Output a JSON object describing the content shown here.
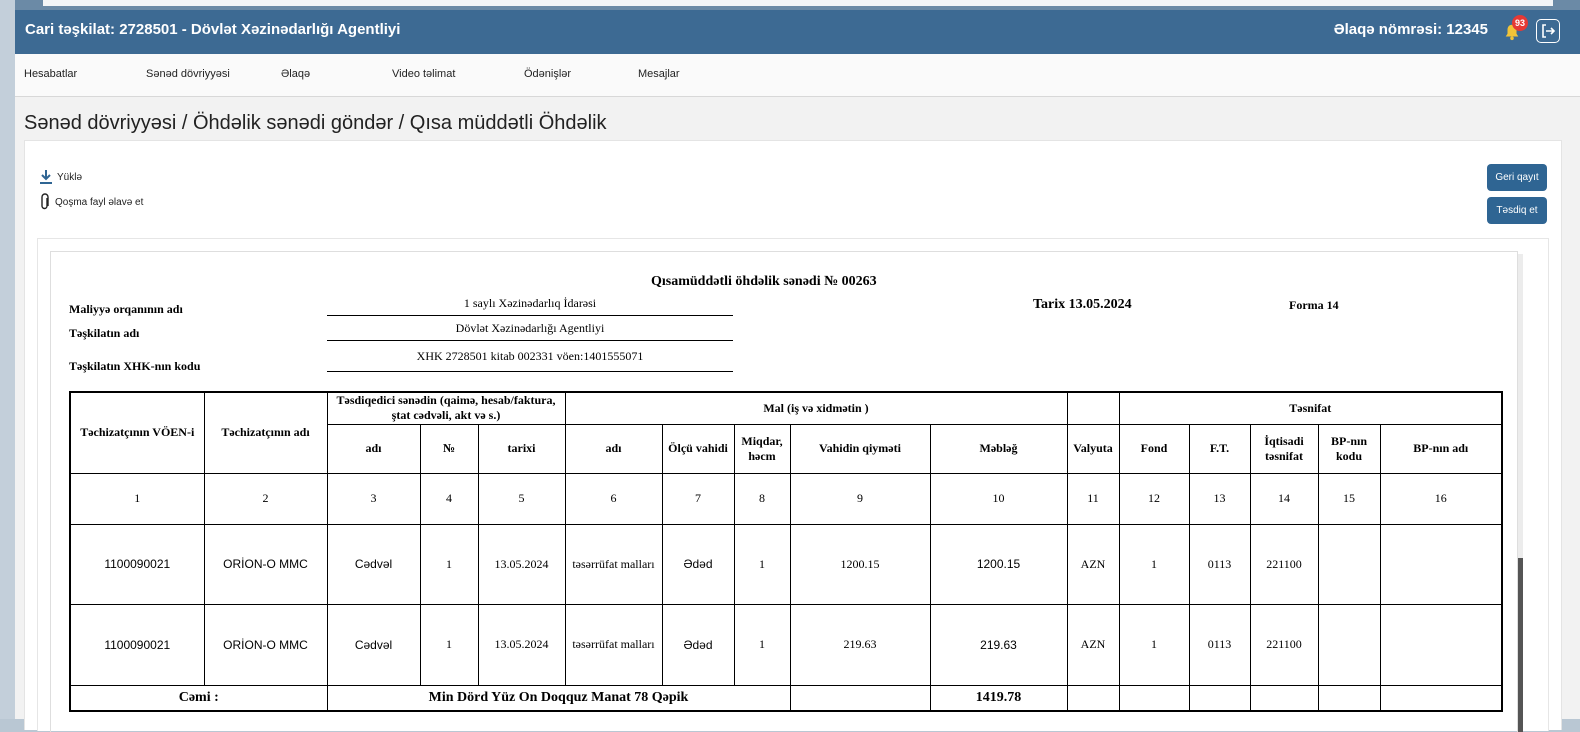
{
  "header": {
    "title": "Cari təşkilat: 2728501 - Dövlət Xəzinədarlığı Agentliyi",
    "phone": "Əlaqə nömrəsi: 12345",
    "notification_count": "93"
  },
  "nav": [
    "Hesabatlar",
    "Sənəd dövriyyəsi",
    "Əlaqə",
    "Video təlimat",
    "Ödənişlər",
    "Mesajlar"
  ],
  "breadcrumb": "Sənəd dövriyyəsi / Öhdəlik sənədi göndər / Qısa müddətli Öhdəlik",
  "toolbar": {
    "download": "Yüklə",
    "attach": "Qoşma fayl əlavə et",
    "back": "Geri qayıt",
    "confirm": "Təsdiq et"
  },
  "doc": {
    "title": "Qısamüddətli öhdəlik sənədi  № 00263",
    "tarix": "Tarix  13.05.2024",
    "forma": "Forma 14",
    "fin_org_label": "Maliyyə orqanının adı",
    "fin_org_value": "1 saylı Xəzinədarlıq İdarəsi",
    "org_label": "Təşkilatın adı",
    "org_value": "Dövlət Xəzinədarlığı Agentliyi",
    "code_label": "Təşkilatın XHK-nın kodu",
    "code_value": "XHK 2728501   kitab 002331   vöen:1401555071"
  },
  "table": {
    "h_voen": "Təchizatçının VÖEN-i",
    "h_supplier": "Təchizatçının adı",
    "h_confirm": "Təsdiqedici sənədin (qaimə, hesab/faktura, ştat cədvəli, akt və s.)",
    "h_goods": "Mal (iş və xidmətin )",
    "h_class": "Təsnifat",
    "h_adi": "adı",
    "h_no": "№",
    "h_tarixi": "tarixi",
    "h_adi2": "adı",
    "h_unit": "Ölçü vahidi",
    "h_qty": "Miqdar, həcm",
    "h_price": "Vahidin qiyməti",
    "h_amount": "Məbləğ",
    "h_currency": "Valyuta",
    "h_fond": "Fond",
    "h_ft": "F.T.",
    "h_econ": "İqtisadi təsnifat",
    "h_bp_code": "BP-nın kodu",
    "h_bp_name": "BP-nın adı",
    "col_numbers": [
      "1",
      "2",
      "3",
      "4",
      "5",
      "6",
      "7",
      "8",
      "9",
      "10",
      "11",
      "12",
      "13",
      "14",
      "15",
      "16"
    ],
    "rows": [
      [
        "1100090021",
        "ORİON-O MMC",
        "Cədvəl",
        "1",
        "13.05.2024",
        "təsərrüfat malları",
        "Ədəd",
        "1",
        "1200.15",
        "1200.15",
        "AZN",
        "1",
        "0113",
        "221100",
        "",
        ""
      ],
      [
        "1100090021",
        "ORİON-O MMC",
        "Cədvəl",
        "1",
        "13.05.2024",
        "təsərrüfat malları",
        "Ədəd",
        "1",
        "219.63",
        "219.63",
        "AZN",
        "1",
        "0113",
        "221100",
        "",
        ""
      ]
    ],
    "total_label": "Cəmi :",
    "total_words": "Min Dörd Yüz On Doqquz  Manat 78 Qəpik",
    "total_amount": "1419.78"
  }
}
